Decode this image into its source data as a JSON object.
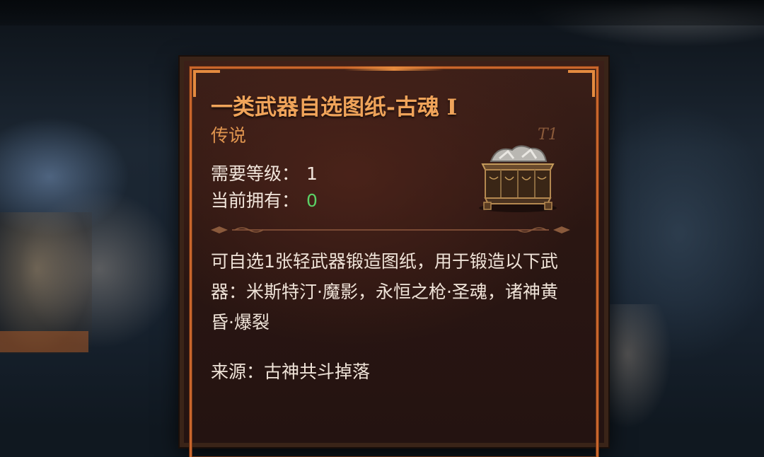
{
  "item": {
    "title": "一类武器自选图纸-古魂 I",
    "rarity": "传说",
    "tier": "T1",
    "icon": "treasure-chest-icon",
    "stats": {
      "level_label": "需要等级：",
      "level_value": "1",
      "owned_label": "当前拥有：",
      "owned_value": "0"
    },
    "description": "可自选1张轻武器锻造图纸，用于锻造以下武器：米斯特汀·魔影，永恒之枪·圣魂，诸神黄昏·爆裂",
    "source": "来源：古神共斗掉落"
  },
  "colors": {
    "title": "#f0a45a",
    "rarity": "#e0954f",
    "owned_value": "#5bd166",
    "frame": "#c9662c",
    "panel_bg": "#2a1612"
  }
}
